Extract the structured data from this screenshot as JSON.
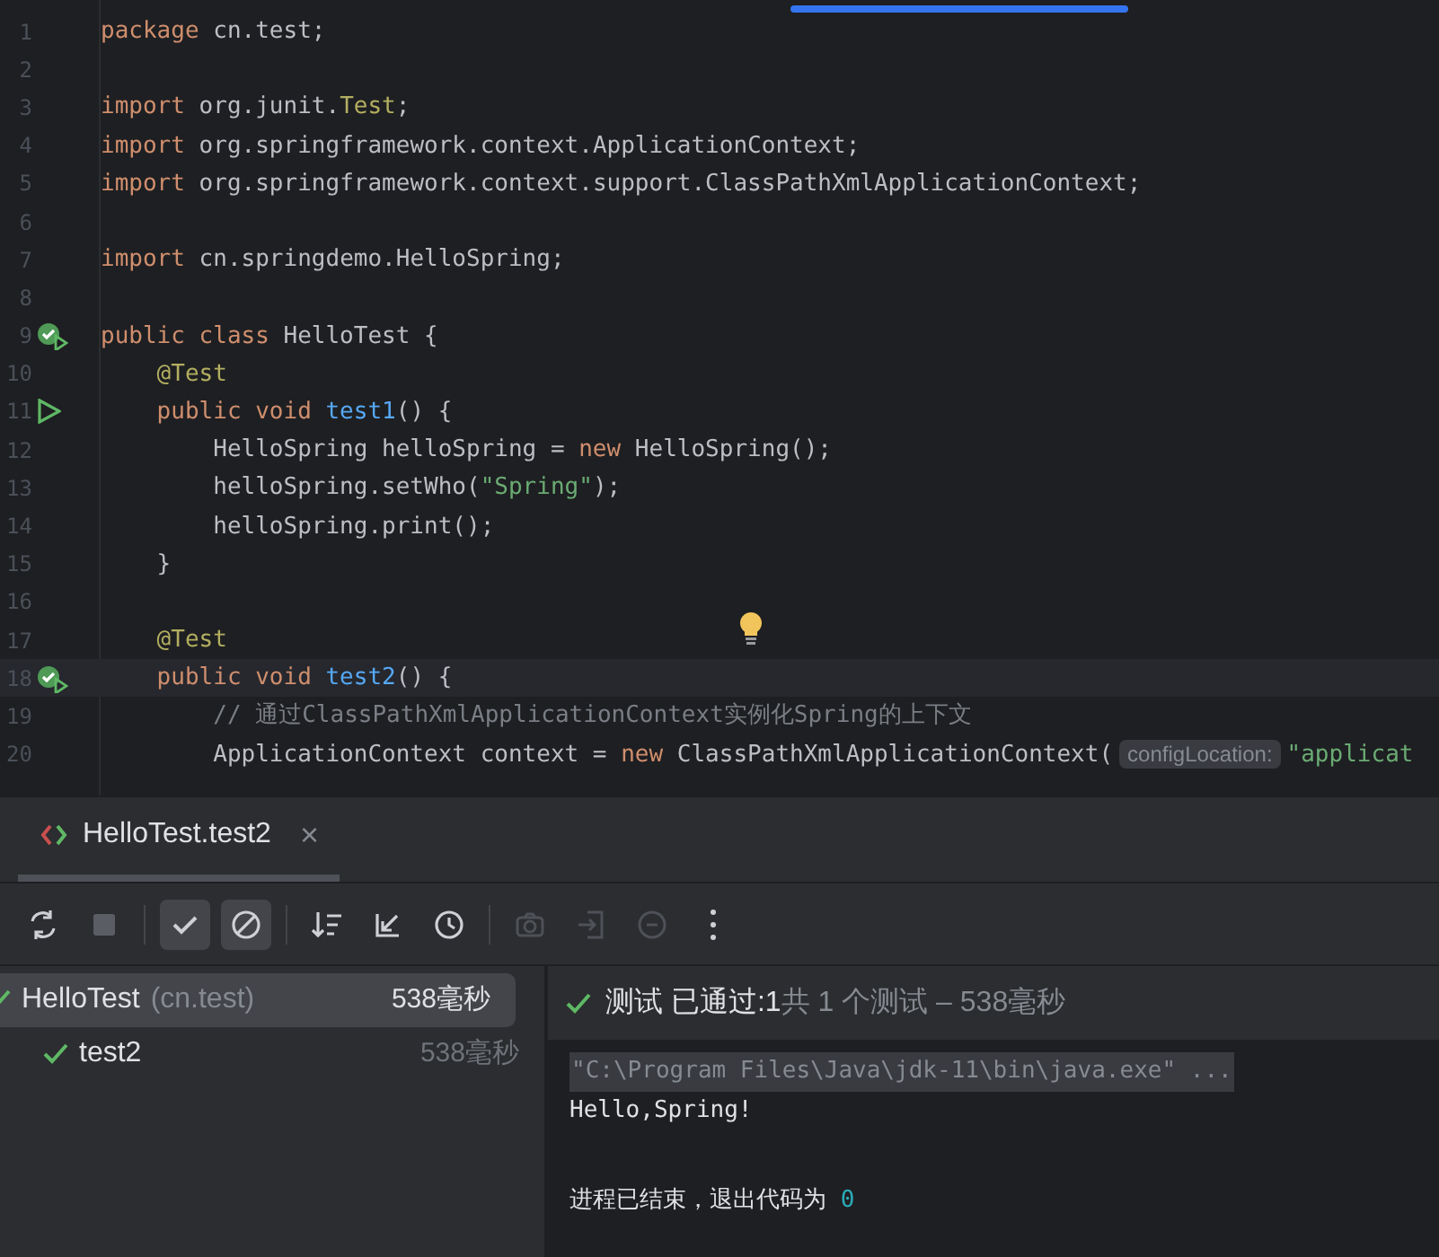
{
  "editor": {
    "lines": [
      {
        "number": "1",
        "runnable": false,
        "tokens": [
          {
            "kind": "kw",
            "text": "package "
          },
          {
            "kind": "plain",
            "text": "cn.test;"
          }
        ]
      },
      {
        "number": "2",
        "runnable": false
      },
      {
        "number": "3",
        "runnable": false,
        "tokens": [
          {
            "kind": "kw",
            "text": "import "
          },
          {
            "kind": "plain",
            "text": "org.junit."
          },
          {
            "kind": "type",
            "text": "Test"
          },
          {
            "kind": "plain",
            "text": ";"
          }
        ]
      },
      {
        "number": "4",
        "runnable": false,
        "tokens": [
          {
            "kind": "kw",
            "text": "import "
          },
          {
            "kind": "plain",
            "text": "org.springframework.context.ApplicationContext;"
          }
        ]
      },
      {
        "number": "5",
        "runnable": false,
        "tokens": [
          {
            "kind": "kw",
            "text": "import "
          },
          {
            "kind": "plain",
            "text": "org.springframework.context.support.ClassPathXmlApplicationContext;"
          }
        ]
      },
      {
        "number": "6",
        "runnable": false
      },
      {
        "number": "7",
        "runnable": false,
        "tokens": [
          {
            "kind": "kw",
            "text": "import "
          },
          {
            "kind": "plain",
            "text": "cn.springdemo.HelloSpring;"
          }
        ]
      },
      {
        "number": "8",
        "runnable": false
      },
      {
        "number": "9",
        "runnable": true,
        "passed": true,
        "tokens": [
          {
            "kind": "kw",
            "text": "public class "
          },
          {
            "kind": "plain",
            "text": "HelloTest {"
          }
        ]
      },
      {
        "number": "10",
        "runnable": false,
        "tokens": [
          {
            "kind": "ann",
            "text": "    @Test"
          }
        ]
      },
      {
        "number": "11",
        "runnable": true,
        "passed": false,
        "tokens": [
          {
            "kind": "kw",
            "text": "    public void "
          },
          {
            "kind": "fn",
            "text": "test1"
          },
          {
            "kind": "plain",
            "text": "() {"
          }
        ]
      },
      {
        "number": "12",
        "runnable": false,
        "tokens": [
          {
            "kind": "plain",
            "text": "        HelloSpring helloSpring = "
          },
          {
            "kind": "kw",
            "text": "new "
          },
          {
            "kind": "plain",
            "text": "HelloSpring();"
          }
        ]
      },
      {
        "number": "13",
        "runnable": false,
        "tokens": [
          {
            "kind": "plain",
            "text": "        helloSpring.setWho("
          },
          {
            "kind": "str",
            "text": "\"Spring\""
          },
          {
            "kind": "plain",
            "text": ");"
          }
        ]
      },
      {
        "number": "14",
        "runnable": false,
        "tokens": [
          {
            "kind": "plain",
            "text": "        helloSpring.print();"
          }
        ]
      },
      {
        "number": "15",
        "runnable": false,
        "tokens": [
          {
            "kind": "plain",
            "text": "    }"
          }
        ]
      },
      {
        "number": "16",
        "runnable": false
      },
      {
        "number": "17",
        "runnable": false,
        "tokens": [
          {
            "kind": "ann",
            "text": "    @Test"
          }
        ]
      },
      {
        "number": "18",
        "runnable": true,
        "passed": true,
        "current": true,
        "tokens": [
          {
            "kind": "kw",
            "text": "    public void "
          },
          {
            "kind": "fn",
            "text": "test2"
          },
          {
            "kind": "plain",
            "text": "() {"
          }
        ]
      },
      {
        "number": "19",
        "runnable": false,
        "tokens": [
          {
            "kind": "comment",
            "text": "        // 通过ClassPathXmlApplicationContext实例化Spring的上下文"
          }
        ]
      },
      {
        "number": "20",
        "runnable": false,
        "tokens": [
          {
            "kind": "plain",
            "text": "        ApplicationContext context = "
          },
          {
            "kind": "kw",
            "text": "new "
          },
          {
            "kind": "plain",
            "text": "ClassPathXmlApplicationContext("
          },
          {
            "kind": "hint",
            "text": "configLocation:"
          },
          {
            "kind": "str",
            "text": "\"applicat"
          }
        ]
      }
    ]
  },
  "run_panel": {
    "tab": {
      "label": "HelloTest.test2",
      "close": "×",
      "selected": true
    },
    "toolbar": [
      {
        "disabled": false,
        "selected": false
      },
      {
        "disabled": true,
        "selected": false
      },
      {
        "disabled": false,
        "selected": true
      },
      {
        "disabled": false,
        "selected": true
      },
      {
        "disabled": false,
        "selected": false
      },
      {
        "disabled": false,
        "selected": false
      },
      {
        "disabled": false,
        "selected": false
      },
      {
        "disabled": true,
        "selected": false
      },
      {
        "disabled": true,
        "selected": false
      },
      {
        "disabled": true,
        "selected": false
      },
      {
        "disabled": false,
        "selected": false
      }
    ],
    "tree": [
      {
        "name": "HelloTest",
        "package": "(cn.test)",
        "time": "538毫秒",
        "selected": true,
        "passed": true,
        "children": [
          {
            "name": "test2",
            "time": "538毫秒",
            "selected": false,
            "passed": true
          }
        ]
      }
    ],
    "status": {
      "passed": true,
      "label": "测试",
      "result": "已通过:",
      "count": "1",
      "summary": "共 1 个测试 – 538毫秒"
    },
    "console": [
      {
        "kind": "command",
        "text": "\"C:\\Program Files\\Java\\jdk-11\\bin\\java.exe\" ..."
      },
      {
        "kind": "output",
        "text": "Hello,Spring!"
      },
      {
        "kind": "exit",
        "text": "进程已结束，退出代码为 ",
        "code": "0"
      }
    ]
  }
}
